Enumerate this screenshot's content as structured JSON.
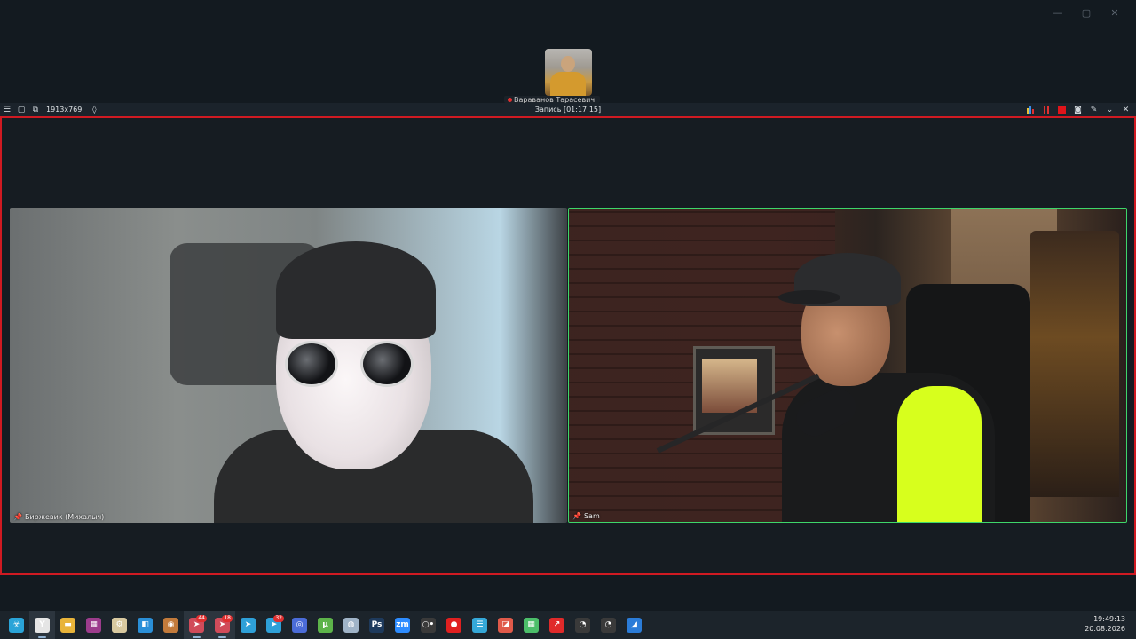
{
  "window": {
    "controls": {
      "minimize": "—",
      "maximize": "▢",
      "close": "✕"
    }
  },
  "self_view": {
    "name": "Вараванов Тарасевич"
  },
  "recording_bar": {
    "menu_icon": "☰",
    "resolution": "1913x769",
    "title": "Запись [01:17:15]",
    "right_icons": [
      "equalizer-icon",
      "pause-icon",
      "stop-icon",
      "camera-icon",
      "pen-icon",
      "collapse-icon",
      "close-icon"
    ]
  },
  "participants": [
    {
      "name": "Биржевик (Михалыч)",
      "active_speaker": false
    },
    {
      "name": "Sam",
      "active_speaker": true
    }
  ],
  "colors": {
    "recording_border": "#d01a22",
    "active_speaker_border": "#3ed66a",
    "background": "#131a20"
  },
  "taskbar": {
    "items": [
      {
        "name": "start-biohazard",
        "glyph": "☣",
        "color": "#2aa4d8"
      },
      {
        "name": "yandex-browser",
        "glyph": "Y",
        "color": "#e5e5e5",
        "active": true
      },
      {
        "name": "file-explorer",
        "glyph": "▬",
        "color": "#e8b43a"
      },
      {
        "name": "winrar",
        "glyph": "▦",
        "color": "#9c3c8c"
      },
      {
        "name": "app-utility",
        "glyph": "⚙",
        "color": "#d8c9a0"
      },
      {
        "name": "app-blue",
        "glyph": "◧",
        "color": "#2a8fd8"
      },
      {
        "name": "app-globe",
        "glyph": "◉",
        "color": "#c27a3b"
      },
      {
        "name": "telegram-1",
        "glyph": "➤",
        "color": "#d14b5a",
        "badge": "44",
        "active": true
      },
      {
        "name": "telegram-2",
        "glyph": "➤",
        "color": "#d14b5a",
        "badge": "18",
        "active": true
      },
      {
        "name": "telegram-3",
        "glyph": "➤",
        "color": "#2ea0d8",
        "badge": ""
      },
      {
        "name": "telegram-4",
        "glyph": "➤",
        "color": "#2ea0d8",
        "badge": "32"
      },
      {
        "name": "app-circle",
        "glyph": "◎",
        "color": "#4b6cd8",
        "badge": ""
      },
      {
        "name": "utorrent",
        "glyph": "µ",
        "color": "#5db44a"
      },
      {
        "name": "steam",
        "glyph": "◍",
        "color": "#a0b4c8"
      },
      {
        "name": "photoshop",
        "glyph": "Ps",
        "color": "#1e3a5c"
      },
      {
        "name": "zoom",
        "glyph": "zm",
        "color": "#2d8cff"
      },
      {
        "name": "app-ring",
        "glyph": "○•",
        "color": "#3a3a3a"
      },
      {
        "name": "recorder",
        "glyph": "●",
        "color": "#e02020"
      },
      {
        "name": "app-notes",
        "glyph": "☰",
        "color": "#35a8d8"
      },
      {
        "name": "app-red",
        "glyph": "◪",
        "color": "#e05a4a"
      },
      {
        "name": "app-green-grid",
        "glyph": "▦",
        "color": "#4cbf6a"
      },
      {
        "name": "app-arrow",
        "glyph": "↗",
        "color": "#e02a2a"
      },
      {
        "name": "obs-1",
        "glyph": "◔",
        "color": "#3a3a3a",
        "badge": ""
      },
      {
        "name": "obs-2",
        "glyph": "◔",
        "color": "#3a3a3a"
      },
      {
        "name": "app-paint",
        "glyph": "◢",
        "color": "#2b7cd8"
      }
    ]
  },
  "clock": {
    "time": "19:49:13",
    "date": "20.08.2026"
  }
}
